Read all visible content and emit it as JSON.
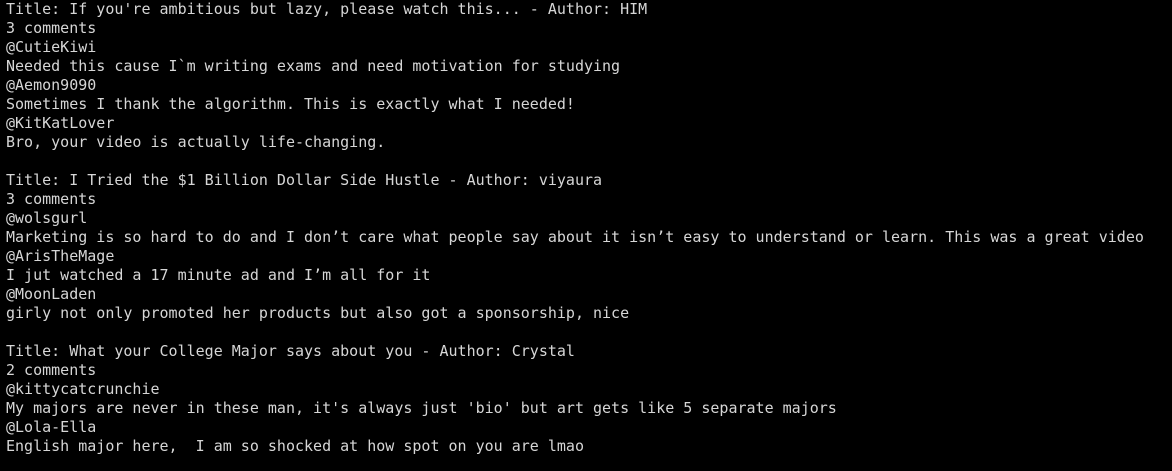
{
  "posts": [
    {
      "title_line": "Title: If you're ambitious but lazy, please watch this... - Author: HIM",
      "comment_count": "3 comments",
      "comments": [
        {
          "user": "@CutieKiwi",
          "text": "Needed this cause I`m writing exams and need motivation for studying"
        },
        {
          "user": "@Aemon9090",
          "text": "Sometimes I thank the algorithm. This is exactly what I needed!"
        },
        {
          "user": "@KitKatLover",
          "text": "Bro, your video is actually life-changing."
        }
      ]
    },
    {
      "title_line": "Title: I Tried the $1 Billion Dollar Side Hustle - Author: viyaura",
      "comment_count": "3 comments",
      "comments": [
        {
          "user": "@wolsgurl",
          "text": "Marketing is so hard to do and I don’t care what people say about it isn’t easy to understand or learn. This was a great video"
        },
        {
          "user": "@ArisTheMage",
          "text": "I jut watched a 17 minute ad and I’m all for it"
        },
        {
          "user": "@MoonLaden",
          "text": "girly not only promoted her products but also got a sponsorship, nice"
        }
      ]
    },
    {
      "title_line": "Title: What your College Major says about you - Author: Crystal",
      "comment_count": "2 comments",
      "comments": [
        {
          "user": "@kittycatcrunchie",
          "text": "My majors are never in these man, it's always just 'bio' but art gets like 5 separate majors"
        },
        {
          "user": "@Lola-Ella",
          "text": "English major here,  I am so shocked at how spot on you are lmao"
        }
      ]
    }
  ]
}
